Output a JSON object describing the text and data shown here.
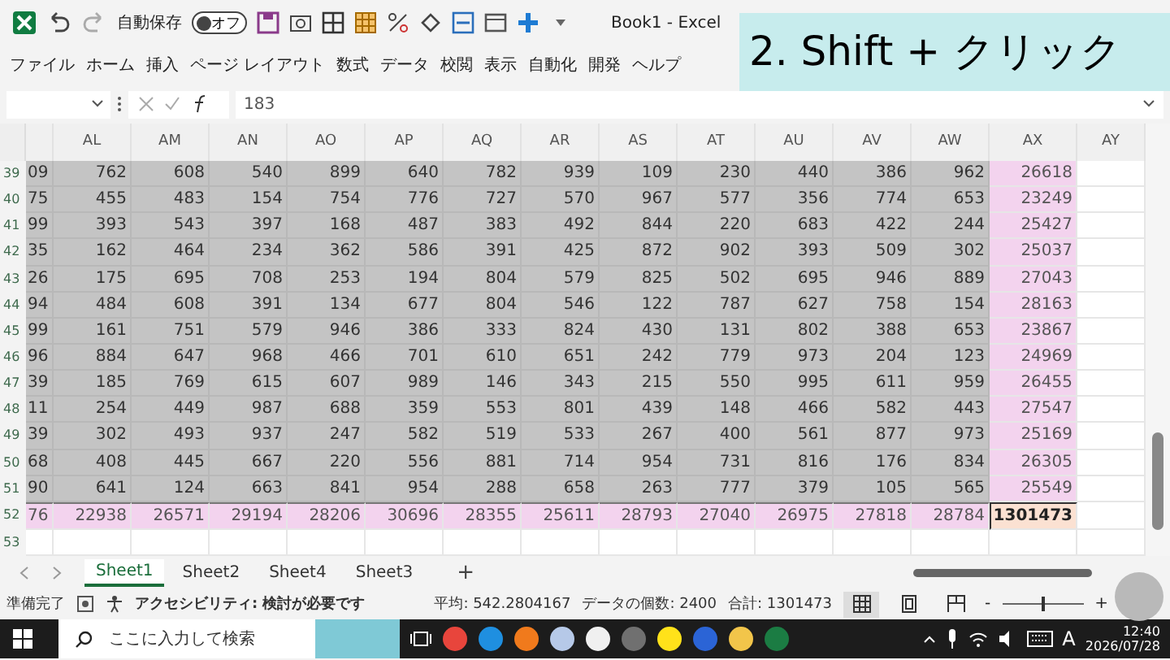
{
  "quick_access": {
    "autosave_label": "自動保存",
    "autosave_toggle": {
      "label": "オフ",
      "on": false
    }
  },
  "window": {
    "title": "Book1  -  Excel"
  },
  "caption": "2. Shift + クリック",
  "menu": [
    "ファイル",
    "ホーム",
    "挿入",
    "ページ レイアウト",
    "数式",
    "データ",
    "校閲",
    "表示",
    "自動化",
    "開発",
    "ヘルプ"
  ],
  "formula_bar": {
    "value": "183"
  },
  "sheet": {
    "columns": [
      "",
      "AL",
      "AM",
      "AN",
      "AO",
      "AP",
      "AQ",
      "AR",
      "AS",
      "AT",
      "AU",
      "AV",
      "AW",
      "AX",
      "AY"
    ],
    "rows": [
      {
        "number": "39",
        "kind": "data",
        "cells": [
          "09",
          "762",
          "608",
          "540",
          "899",
          "640",
          "782",
          "939",
          "109",
          "230",
          "440",
          "386",
          "962",
          "26618"
        ]
      },
      {
        "number": "40",
        "kind": "data",
        "cells": [
          "75",
          "455",
          "483",
          "154",
          "754",
          "776",
          "727",
          "570",
          "967",
          "577",
          "356",
          "774",
          "653",
          "23249"
        ]
      },
      {
        "number": "41",
        "kind": "data",
        "cells": [
          "99",
          "393",
          "543",
          "397",
          "168",
          "487",
          "383",
          "492",
          "844",
          "220",
          "683",
          "422",
          "244",
          "25427"
        ]
      },
      {
        "number": "42",
        "kind": "data",
        "cells": [
          "35",
          "162",
          "464",
          "234",
          "362",
          "586",
          "391",
          "425",
          "872",
          "902",
          "393",
          "509",
          "302",
          "25037"
        ]
      },
      {
        "number": "43",
        "kind": "data",
        "cells": [
          "26",
          "175",
          "695",
          "708",
          "253",
          "194",
          "804",
          "579",
          "825",
          "502",
          "695",
          "946",
          "889",
          "27043"
        ]
      },
      {
        "number": "44",
        "kind": "data",
        "cells": [
          "94",
          "484",
          "608",
          "391",
          "134",
          "677",
          "804",
          "546",
          "122",
          "787",
          "627",
          "758",
          "154",
          "28163"
        ]
      },
      {
        "number": "45",
        "kind": "data",
        "cells": [
          "99",
          "161",
          "751",
          "579",
          "946",
          "386",
          "333",
          "824",
          "430",
          "131",
          "802",
          "388",
          "653",
          "23867"
        ]
      },
      {
        "number": "46",
        "kind": "data",
        "cells": [
          "96",
          "884",
          "647",
          "968",
          "466",
          "701",
          "610",
          "651",
          "242",
          "779",
          "973",
          "204",
          "123",
          "24969"
        ]
      },
      {
        "number": "47",
        "kind": "data",
        "cells": [
          "39",
          "185",
          "769",
          "615",
          "607",
          "989",
          "146",
          "343",
          "215",
          "550",
          "995",
          "611",
          "959",
          "26455"
        ]
      },
      {
        "number": "48",
        "kind": "data",
        "cells": [
          "11",
          "254",
          "449",
          "987",
          "688",
          "359",
          "553",
          "801",
          "439",
          "148",
          "466",
          "582",
          "443",
          "27547"
        ]
      },
      {
        "number": "49",
        "kind": "data",
        "cells": [
          "39",
          "302",
          "493",
          "937",
          "247",
          "582",
          "519",
          "533",
          "267",
          "400",
          "561",
          "877",
          "973",
          "25169"
        ]
      },
      {
        "number": "50",
        "kind": "data",
        "cells": [
          "68",
          "408",
          "445",
          "667",
          "220",
          "556",
          "881",
          "714",
          "954",
          "731",
          "816",
          "176",
          "834",
          "26305"
        ]
      },
      {
        "number": "51",
        "kind": "data",
        "cells": [
          "90",
          "641",
          "124",
          "663",
          "841",
          "954",
          "288",
          "658",
          "263",
          "777",
          "379",
          "105",
          "565",
          "25549"
        ]
      },
      {
        "number": "52",
        "kind": "total",
        "cells": [
          "76",
          "22938",
          "26571",
          "29194",
          "28206",
          "30696",
          "28355",
          "25611",
          "28793",
          "27040",
          "26975",
          "27818",
          "28784",
          "1301473"
        ]
      },
      {
        "number": "53",
        "kind": "empty",
        "cells": []
      }
    ]
  },
  "sheet_tabs": [
    {
      "label": "Sheet1",
      "selected": true
    },
    {
      "label": "Sheet2",
      "selected": false
    },
    {
      "label": "Sheet4",
      "selected": false
    },
    {
      "label": "Sheet3",
      "selected": false
    }
  ],
  "add_sheet": "+",
  "status_bar": {
    "ready": "準備完了",
    "accessibility": "アクセシビリティ: 検討が必要です",
    "average": "平均: 542.2804167",
    "count": "データの個数: 2400",
    "sum": "合計: 1301473",
    "zoom": {
      "minus": "-",
      "plus": "+",
      "level": 0.5
    }
  },
  "taskbar": {
    "search_placeholder": "ここに入力して検索",
    "ime": "A",
    "time": "12:40",
    "date": "2026/07/28"
  }
}
